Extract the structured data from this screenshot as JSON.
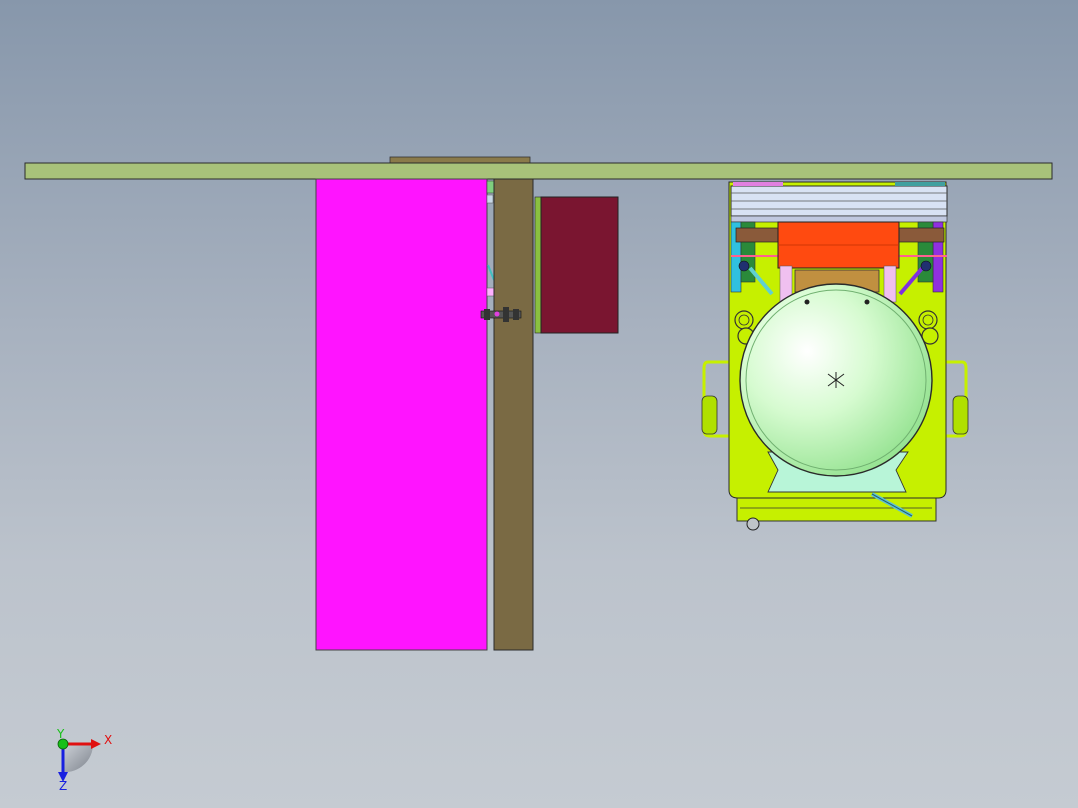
{
  "viewport": {
    "background_top": "#8797ab",
    "background_bottom": "#c5cbd2"
  },
  "colors": {
    "plate": "#a8c27a",
    "magenta_panel": "#ff14ff",
    "post": "#7a6a44",
    "maroon_box": "#7a1530",
    "machine_body": "#c6f000",
    "tank": "#c8f7c0",
    "orange_block": "#ff4a10"
  },
  "triad": {
    "x_label": "X",
    "y_label": "Y",
    "z_label": "Z",
    "x_color": "#e01010",
    "y_color": "#18c018",
    "z_color": "#1820e0"
  }
}
